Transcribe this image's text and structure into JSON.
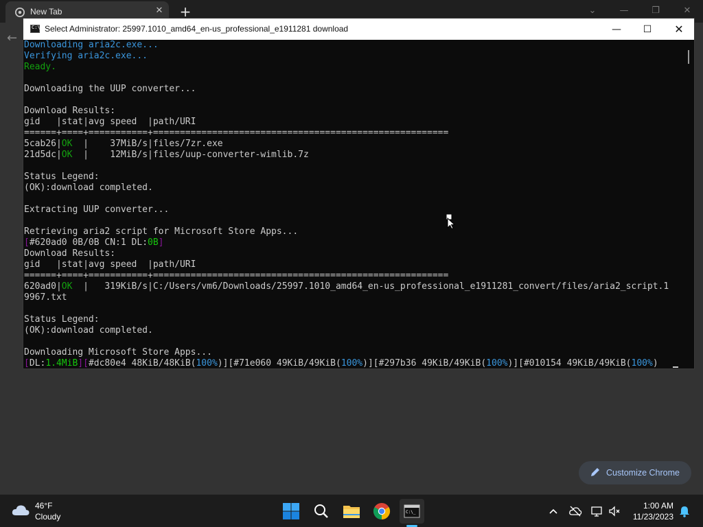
{
  "browser": {
    "tab_title": "New Tab",
    "customize_label": "Customize Chrome"
  },
  "terminal": {
    "title": "Select Administrator:  25997.1010_amd64_en-us_professional_e1911281 download",
    "icon_text": "C:\\",
    "lines": {
      "l1": "Downloading aria2c.exe...",
      "l2": "Verifying aria2c.exe...",
      "l3": "Ready.",
      "l5": "Downloading the UUP converter...",
      "l7": "Download Results:",
      "l8": "gid   |stat|avg speed  |path/URI",
      "l9": "======+====+===========+=======================================================",
      "l10a": "5cab26|",
      "l10b": "OK",
      "l10c": "  |    37MiB/s|files/7zr.exe",
      "l11a": "21d5dc|",
      "l11b": "OK",
      "l11c": "  |    12MiB/s|files/uup-converter-wimlib.7z",
      "l13": "Status Legend:",
      "l14": "(OK):download completed.",
      "l16": "Extracting UUP converter...",
      "l18": "Retrieving aria2 script for Microsoft Store Apps...",
      "l19a": "[",
      "l19b": "#620ad0 0B/0B CN:1 DL:",
      "l19c": "0B",
      "l19d": "]",
      "l20": "Download Results:",
      "l21": "gid   |stat|avg speed  |path/URI",
      "l22": "======+====+===========+=======================================================",
      "l23a": "620ad0|",
      "l23b": "OK",
      "l23c": "  |   319KiB/s|C:/Users/vm6/Downloads/25997.1010_amd64_en-us_professional_e1911281_convert/files/aria2_script.1",
      "l24": "9967.txt",
      "l26": "Status Legend:",
      "l27": "(OK):download completed.",
      "l29": "Downloading Microsoft Store Apps...",
      "l30a": "[",
      "l30b": "DL:",
      "l30c": "1.4MiB",
      "l30d": "][",
      "l30e": "#dc80e4 48KiB/48KiB(",
      "l30f": "100%",
      "l30g": ")][",
      "l30h": "#71e060 49KiB/49KiB(",
      "l30i": "100%",
      "l30j": ")][",
      "l30k": "#297b36 49KiB/49KiB(",
      "l30l": "100%",
      "l30m": ")][",
      "l30n": "#010154 49KiB/49KiB(",
      "l30o": "100%",
      "l30p": ")"
    }
  },
  "taskbar": {
    "weather_temp": "46°F",
    "weather_condition": "Cloudy",
    "clock_time": "1:00 AM",
    "clock_date": "11/23/2023"
  },
  "colors": {
    "terminal_bg": "#0c0c0c",
    "terminal_text": "#cccccc",
    "cyan": "#3a96dd",
    "green": "#13a10e",
    "purple": "#881798",
    "accent": "#4cc2ff"
  }
}
